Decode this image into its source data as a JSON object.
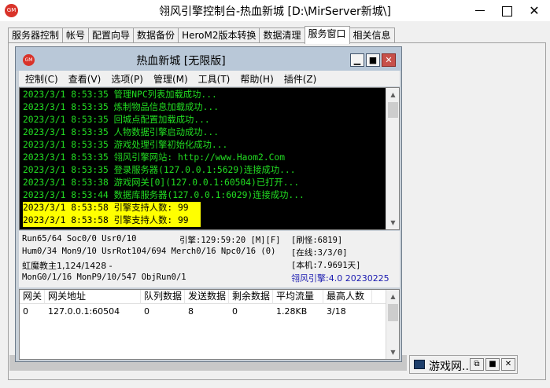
{
  "window": {
    "title": "翎风引擎控制台-热血新城 [D:\\MirServer新城\\]",
    "app_icon_text": "GM",
    "minimize": "—",
    "maximize": "☐",
    "close": "✕"
  },
  "tabs": [
    {
      "label": "服务器控制"
    },
    {
      "label": "帐号"
    },
    {
      "label": "配置向导"
    },
    {
      "label": "数据备份"
    },
    {
      "label": "HeroM2版本转换"
    },
    {
      "label": "数据清理"
    },
    {
      "label": "服务窗口",
      "active": true
    },
    {
      "label": "相关信息"
    }
  ],
  "child_window": {
    "title": "热血新城 [无限版]",
    "icon_text": "GM",
    "min": "▁",
    "max": "■",
    "close": "✕",
    "menu": [
      "控制(C)",
      "查看(V)",
      "选项(P)",
      "管理(M)",
      "工具(T)",
      "帮助(H)",
      "插件(Z)"
    ],
    "log_lines": [
      {
        "text": "2023/3/1 8:53:35 管理NPC列表加载成功...",
        "highlight": false
      },
      {
        "text": "2023/3/1 8:53:35 炼制物品信息加载成功...",
        "highlight": false
      },
      {
        "text": "2023/3/1 8:53:35 回城点配置加载成功...",
        "highlight": false
      },
      {
        "text": "2023/3/1 8:53:35 人物数据引擎启动成功...",
        "highlight": false
      },
      {
        "text": "2023/3/1 8:53:35 游戏处理引擎初始化成功...",
        "highlight": false
      },
      {
        "text": "2023/3/1 8:53:35 翎风引擎网站: http://www.Haom2.Com",
        "highlight": false
      },
      {
        "text": "2023/3/1 8:53:35 登录服务器(127.0.0.1:5629)连接成功...",
        "highlight": false
      },
      {
        "text": "2023/3/1 8:53:38 游戏网关[0](127.0.0.1:60504)已打开...",
        "highlight": false
      },
      {
        "text": "2023/3/1 8:53:44 数据库服务器(127.0.0.1:6029)连接成功...",
        "highlight": false
      },
      {
        "text": "2023/3/1 8:53:58 引擎支持人数: 99",
        "highlight": true
      },
      {
        "text": "2023/3/1 8:53:58 引擎支持人数: 99",
        "highlight": true
      }
    ],
    "status": {
      "line1_left": "Run65/64 Soc0/0 Usr0/10",
      "line1_mid": "引擎:129:59:20 [M][F]",
      "line1_right": "[刷怪:6819]",
      "line2_left": "Hum0/34 Mon9/10 UsrRot104/694 Merch0/16 Npc0/16 (0)",
      "line2_right": "[在线:3/3/0]",
      "line3_left": "虹魔教主1,124/1428 -",
      "line3_right": "[本机:7.9691天]",
      "line4_left": "MonG0/1/16 MonP9/10/547 ObjRun0/1",
      "line4_right": "翎风引擎:4.0 20230225"
    },
    "table": {
      "headers": [
        "网关",
        "网关地址",
        "队列数据",
        "发送数据",
        "剩余数据",
        "平均流量",
        "最高人数"
      ],
      "rows": [
        [
          "0",
          "127.0.0.1:60504",
          "0",
          "8",
          "0",
          "1.28KB",
          "3/18"
        ]
      ]
    }
  },
  "minimized_window": {
    "label": "游戏网...",
    "restore": "⧉",
    "max": "■",
    "close": "✕"
  },
  "colors": {
    "log_text": "#22dd22",
    "log_highlight_bg": "#ffff00",
    "version_text": "#1a1ab0",
    "close_button": "#c7504a"
  }
}
